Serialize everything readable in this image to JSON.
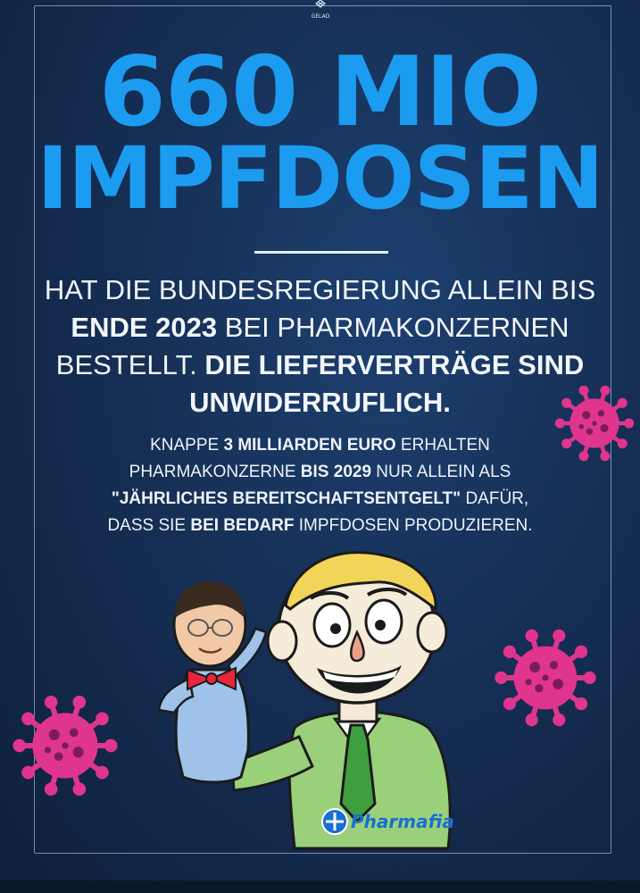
{
  "logo": {
    "text": "GELAD",
    "icon": "emblem-icon"
  },
  "headline": {
    "line1": "660 MIO",
    "line2": "IMPFDOSEN"
  },
  "para1": {
    "a": "HAT DIE BUNDESREGIERUNG ALLEIN BIS",
    "b_bold": "ENDE 2023",
    "c": " BEI PHARMAKONZERNEN",
    "d": "BESTELLT. ",
    "e_bold": "DIE LIEFERVERTRÄGE SIND",
    "f_bold": "UNWIDERRUFLICH."
  },
  "para2": {
    "s1": "KNAPPE ",
    "s2_bold": "3 MILLIARDEN EURO",
    "s3": " ERHALTEN",
    "s4": "PHARMAKONZERNE ",
    "s5_bold": "BIS 2029",
    "s6": " NUR ALLEIN ALS",
    "s7_bold": "\"JÄHRLICHES BEREITSCHAFTSENTGELT\"",
    "s8": " DAFÜR,",
    "s9": "DASS SIE ",
    "s10_bold": "BEI BEDARF",
    "s11": " IMPFDOSEN PRODUZIEREN."
  },
  "illustration": {
    "badge_text": "Pharmafia"
  },
  "colors": {
    "headline": "#1c9cf0",
    "virus": "#e0358f",
    "background": "#162f55"
  }
}
